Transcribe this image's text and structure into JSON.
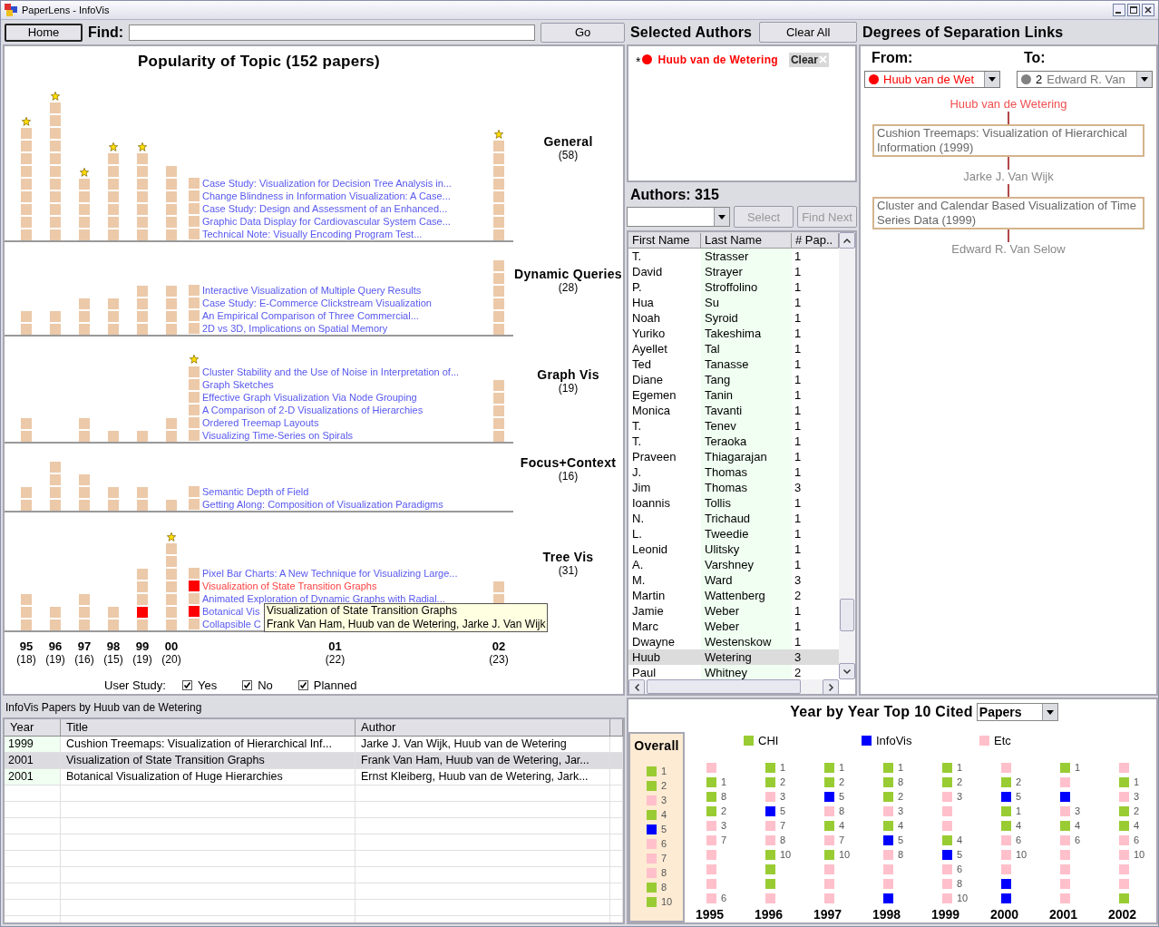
{
  "window": {
    "title": "PaperLens - InfoVis"
  },
  "toolbar": {
    "home": "Home",
    "find_label": "Find:",
    "go": "Go"
  },
  "popularity": {
    "title": "Popularity of Topic (152 papers)",
    "topics": [
      {
        "name": "General",
        "count": "(58)",
        "columns": [
          {
            "kind": "stack",
            "starred": true,
            "cells": [
              false,
              false,
              false,
              false,
              false,
              false,
              false,
              false,
              false
            ]
          },
          {
            "kind": "stack",
            "starred": true,
            "cells": [
              false,
              false,
              false,
              false,
              false,
              false,
              false,
              false,
              false,
              false,
              false
            ]
          },
          {
            "kind": "stack",
            "starred": true,
            "cells": [
              false,
              false,
              false,
              false,
              false
            ]
          },
          {
            "kind": "stack",
            "starred": true,
            "cells": [
              false,
              false,
              false,
              false,
              false,
              false,
              false
            ]
          },
          {
            "kind": "stack",
            "starred": true,
            "cells": [
              false,
              false,
              false,
              false,
              false,
              false,
              false
            ]
          },
          {
            "kind": "stack",
            "cells": [
              false,
              false,
              false,
              false,
              false,
              false
            ]
          },
          {
            "kind": "papers",
            "papers": [
              {
                "title": "Case Study: Visualization for Decision Tree Analysis in...",
                "highlighted": false,
                "hovered": false
              },
              {
                "title": "Change Blindness in Information Visualization: A Case...",
                "highlighted": false,
                "hovered": false
              },
              {
                "title": "Case Study: Design and Assessment of an Enhanced...",
                "highlighted": false,
                "hovered": false
              },
              {
                "title": "Graphic Data Display for Cardiovascular System Case...",
                "highlighted": false,
                "hovered": false
              },
              {
                "title": "Technical Note: Visually Encoding Program Test...",
                "highlighted": false,
                "hovered": false
              }
            ]
          },
          {
            "kind": "stack",
            "starred": true,
            "cells": [
              false,
              false,
              false,
              false,
              false,
              false,
              false,
              false
            ]
          }
        ]
      },
      {
        "name": "Dynamic Queries",
        "count": "(28)",
        "columns": [
          {
            "kind": "stack",
            "cells": [
              false,
              false
            ]
          },
          {
            "kind": "stack",
            "cells": [
              false,
              false
            ]
          },
          {
            "kind": "stack",
            "cells": [
              false,
              false,
              false
            ]
          },
          {
            "kind": "stack",
            "cells": [
              false,
              false,
              false
            ]
          },
          {
            "kind": "stack",
            "cells": [
              false,
              false,
              false,
              false
            ]
          },
          {
            "kind": "stack",
            "cells": [
              false,
              false,
              false,
              false
            ]
          },
          {
            "kind": "papers",
            "papers": [
              {
                "title": "Interactive Visualization of Multiple Query Results",
                "highlighted": false,
                "hovered": false
              },
              {
                "title": "Case Study: E-Commerce Clickstream Visualization",
                "highlighted": false,
                "hovered": false
              },
              {
                "title": "An Empirical Comparison of Three Commercial...",
                "highlighted": false,
                "hovered": false
              },
              {
                "title": "2D vs 3D, Implications on Spatial Memory",
                "highlighted": false,
                "hovered": false
              }
            ]
          },
          {
            "kind": "stack",
            "cells": [
              false,
              false,
              false,
              false,
              false,
              false
            ]
          }
        ]
      },
      {
        "name": "Graph Vis",
        "count": "(19)",
        "columns": [
          {
            "kind": "stack",
            "cells": [
              false,
              false
            ]
          },
          {
            "kind": "stack"
          },
          {
            "kind": "stack",
            "cells": [
              false,
              false
            ]
          },
          {
            "kind": "stack",
            "cells": [
              false
            ]
          },
          {
            "kind": "stack",
            "cells": [
              false
            ]
          },
          {
            "kind": "stack",
            "cells": [
              false,
              false
            ]
          },
          {
            "kind": "papers",
            "starred": true,
            "papers": [
              {
                "title": "Cluster Stability and the Use of Noise in Interpretation of...",
                "highlighted": false,
                "hovered": false
              },
              {
                "title": "Graph Sketches",
                "highlighted": false,
                "hovered": false
              },
              {
                "title": "Effective Graph Visualization Via Node Grouping",
                "highlighted": false,
                "hovered": false
              },
              {
                "title": "A Comparison of 2-D Visualizations of Hierarchies",
                "highlighted": false,
                "hovered": false
              },
              {
                "title": "Ordered Treemap Layouts",
                "highlighted": false,
                "hovered": false
              },
              {
                "title": "Visualizing Time-Series on Spirals",
                "highlighted": false,
                "hovered": false
              }
            ]
          },
          {
            "kind": "stack",
            "cells": [
              false,
              false,
              false,
              false,
              false
            ]
          }
        ]
      },
      {
        "name": "Focus+Context",
        "count": "(16)",
        "columns": [
          {
            "kind": "stack",
            "cells": [
              false,
              false
            ]
          },
          {
            "kind": "stack",
            "cells": [
              false,
              false,
              false,
              false
            ]
          },
          {
            "kind": "stack",
            "cells": [
              false,
              false,
              false
            ]
          },
          {
            "kind": "stack",
            "cells": [
              false,
              false
            ]
          },
          {
            "kind": "stack",
            "cells": [
              false,
              false
            ]
          },
          {
            "kind": "stack",
            "cells": [
              false
            ]
          },
          {
            "kind": "papers",
            "papers": [
              {
                "title": "Semantic Depth of Field",
                "highlighted": false,
                "hovered": false
              },
              {
                "title": "Getting Along: Composition of Visualization Paradigms",
                "highlighted": false,
                "hovered": false
              }
            ]
          },
          {
            "kind": "stack"
          }
        ]
      },
      {
        "name": "Tree Vis",
        "count": "(31)",
        "columns": [
          {
            "kind": "stack",
            "cells": [
              false,
              false,
              false
            ]
          },
          {
            "kind": "stack",
            "cells": [
              false,
              false
            ]
          },
          {
            "kind": "stack",
            "cells": [
              false,
              false,
              false
            ]
          },
          {
            "kind": "stack",
            "cells": [
              false,
              false
            ]
          },
          {
            "kind": "stack",
            "cells": [
              false,
              true,
              false,
              false,
              false
            ]
          },
          {
            "kind": "stack",
            "starred": true,
            "cells": [
              false,
              false,
              false,
              false,
              false,
              false,
              false
            ]
          },
          {
            "kind": "papers",
            "papers": [
              {
                "title": "Pixel Bar Charts: A New Technique for Visualizing Large...",
                "highlighted": false,
                "hovered": false
              },
              {
                "title": "Visualization of State Transition Graphs",
                "highlighted": true,
                "hovered": true
              },
              {
                "title": "Animated Exploration of Dynamic Graphs with Radial...",
                "highlighted": false,
                "hovered": false
              },
              {
                "title": "Botanical Vis",
                "highlighted": true,
                "hovered": false
              },
              {
                "title": "Collapsible C",
                "highlighted": false,
                "hovered": false
              }
            ],
            "tooltip": {
              "title": "Visualization of State Transition Graphs",
              "authors": "Frank Van Ham, Huub van de Wetering, Jarke J. Van Wijk"
            }
          },
          {
            "kind": "stack",
            "cells": [
              false,
              false
            ]
          }
        ]
      }
    ],
    "axis": [
      {
        "label": "95",
        "count": "(18)"
      },
      {
        "label": "96",
        "count": "(19)"
      },
      {
        "label": "97",
        "count": "(16)"
      },
      {
        "label": "98",
        "count": "(15)"
      },
      {
        "label": "99",
        "count": "(19)"
      },
      {
        "label": "00",
        "count": "(20)"
      },
      {
        "label": "01",
        "count": "(22)"
      },
      {
        "label": "02",
        "count": "(23)"
      }
    ],
    "user_study": {
      "label": "User Study:",
      "options": [
        {
          "label": "Yes",
          "checked": true
        },
        {
          "label": "No",
          "checked": true
        },
        {
          "label": "Planned",
          "checked": true
        }
      ]
    }
  },
  "selected_authors": {
    "header": "Selected Authors",
    "clear_all": "Clear All",
    "items": [
      {
        "marker": "*",
        "name": "Huub van de Wetering",
        "color": "#ff0000",
        "clear": "Clear"
      }
    ]
  },
  "authors": {
    "header": "Authors: 315",
    "select": "Select",
    "find_next": "Find Next",
    "buttons_disabled": true,
    "columns": [
      "First Name",
      "Last Name",
      "# Pap.."
    ],
    "rows": [
      {
        "first": "T.",
        "last": "Strasser",
        "papers": "1",
        "selected": false
      },
      {
        "first": "David",
        "last": "Strayer",
        "papers": "1",
        "selected": false
      },
      {
        "first": "P.",
        "last": "Stroffolino",
        "papers": "1",
        "selected": false
      },
      {
        "first": "Hua",
        "last": "Su",
        "papers": "1",
        "selected": false
      },
      {
        "first": "Noah",
        "last": "Syroid",
        "papers": "1",
        "selected": false
      },
      {
        "first": "Yuriko",
        "last": "Takeshima",
        "papers": "1",
        "selected": false
      },
      {
        "first": "Ayellet",
        "last": "Tal",
        "papers": "1",
        "selected": false
      },
      {
        "first": "Ted",
        "last": "Tanasse",
        "papers": "1",
        "selected": false
      },
      {
        "first": "Diane",
        "last": "Tang",
        "papers": "1",
        "selected": false
      },
      {
        "first": "Egemen",
        "last": "Tanin",
        "papers": "1",
        "selected": false
      },
      {
        "first": "Monica",
        "last": "Tavanti",
        "papers": "1",
        "selected": false
      },
      {
        "first": "T.",
        "last": "Tenev",
        "papers": "1",
        "selected": false
      },
      {
        "first": "T.",
        "last": "Teraoka",
        "papers": "1",
        "selected": false
      },
      {
        "first": "Praveen",
        "last": "Thiagarajan",
        "papers": "1",
        "selected": false
      },
      {
        "first": "J.",
        "last": "Thomas",
        "papers": "1",
        "selected": false
      },
      {
        "first": "Jim",
        "last": "Thomas",
        "papers": "3",
        "selected": false
      },
      {
        "first": "Ioannis",
        "last": "Tollis",
        "papers": "1",
        "selected": false
      },
      {
        "first": "N.",
        "last": "Trichaud",
        "papers": "1",
        "selected": false
      },
      {
        "first": "L.",
        "last": "Tweedie",
        "papers": "1",
        "selected": false
      },
      {
        "first": "Leonid",
        "last": "Ulitsky",
        "papers": "1",
        "selected": false
      },
      {
        "first": "A.",
        "last": "Varshney",
        "papers": "1",
        "selected": false
      },
      {
        "first": "M.",
        "last": "Ward",
        "papers": "3",
        "selected": false
      },
      {
        "first": "Martin",
        "last": "Wattenberg",
        "papers": "2",
        "selected": false
      },
      {
        "first": "Jamie",
        "last": "Weber",
        "papers": "1",
        "selected": false
      },
      {
        "first": "Marc",
        "last": "Weber",
        "papers": "1",
        "selected": false
      },
      {
        "first": "Dwayne",
        "last": "Westenskow",
        "papers": "1",
        "selected": false
      },
      {
        "first": "Huub",
        "last": "Wetering",
        "papers": "3",
        "selected": true
      },
      {
        "first": "Paul",
        "last": "Whitney",
        "papers": "2",
        "selected": false
      }
    ]
  },
  "degrees": {
    "header": "Degrees of Separation Links",
    "from_label": "From:",
    "to_label": "To:",
    "from": {
      "color": "#ff0000",
      "value": "Huub van de Wet"
    },
    "to": {
      "color": "#808080",
      "index": "2",
      "value": "Edward R. Van"
    },
    "chain": [
      {
        "kind": "author",
        "text": "Huub van de Wetering",
        "highlighted": true
      },
      {
        "kind": "paper",
        "text": "Cushion Treemaps: Visualization of Hierarchical Information (1999)"
      },
      {
        "kind": "author",
        "text": "Jarke J. Van Wijk",
        "highlighted": false
      },
      {
        "kind": "paper",
        "text": "Cluster and Calendar Based Visualization of Time Series Data (1999)"
      },
      {
        "kind": "author",
        "text": "Edward R. Van Selow",
        "highlighted": false
      }
    ]
  },
  "papers_table": {
    "title": "InfoVis Papers by Huub van de Wetering",
    "columns": [
      "Year",
      "Title",
      "Author"
    ],
    "rows": [
      {
        "year": "1999",
        "title": "Cushion Treemaps: Visualization of Hierarchical Inf...",
        "author": "Jarke J. Van Wijk, Huub van de Wetering",
        "selected": false
      },
      {
        "year": "2001",
        "title": "Visualization of State Transition Graphs",
        "author": "Frank Van Ham, Huub van de Wetering, Jar...",
        "selected": true
      },
      {
        "year": "2001",
        "title": "Botanical Visualization of Huge Hierarchies",
        "author": "Ernst Kleiberg, Huub van de Wetering, Jark...",
        "selected": false
      }
    ]
  },
  "top10": {
    "title": "Year by Year Top 10 Cited",
    "mode": "Papers",
    "legend": [
      {
        "name": "CHI",
        "color": "#99cc33"
      },
      {
        "name": "InfoVis",
        "color": "#0000ff"
      },
      {
        "name": "Etc",
        "color": "#ffc0cb"
      }
    ],
    "overall": {
      "label": "Overall",
      "items": [
        {
          "color": "#99cc33",
          "rank": "1"
        },
        {
          "color": "#99cc33",
          "rank": "2"
        },
        {
          "color": "#ffc0cb",
          "rank": "3"
        },
        {
          "color": "#99cc33",
          "rank": "4"
        },
        {
          "color": "#0000ff",
          "rank": "5"
        },
        {
          "color": "#ffc0cb",
          "rank": "6"
        },
        {
          "color": "#ffc0cb",
          "rank": "7"
        },
        {
          "color": "#ffc0cb",
          "rank": "8"
        },
        {
          "color": "#99cc33",
          "rank": "8"
        },
        {
          "color": "#99cc33",
          "rank": "10"
        }
      ]
    },
    "years": [
      {
        "year": "1995",
        "items": [
          {
            "color": "#ffc0cb"
          },
          {
            "color": "#99cc33",
            "rank": "1"
          },
          {
            "color": "#99cc33",
            "rank": "8"
          },
          {
            "color": "#99cc33",
            "rank": "2"
          },
          {
            "color": "#ffc0cb",
            "rank": "3"
          },
          {
            "color": "#ffc0cb",
            "rank": "7"
          },
          {
            "color": "#ffc0cb"
          },
          {
            "color": "#ffc0cb"
          },
          {
            "color": "#ffc0cb"
          },
          {
            "color": "#ffc0cb",
            "rank": "6"
          }
        ]
      },
      {
        "year": "1996",
        "items": [
          {
            "color": "#99cc33",
            "rank": "1"
          },
          {
            "color": "#99cc33",
            "rank": "2"
          },
          {
            "color": "#ffc0cb",
            "rank": "3"
          },
          {
            "color": "#0000ff",
            "rank": "5"
          },
          {
            "color": "#ffc0cb",
            "rank": "7"
          },
          {
            "color": "#ffc0cb",
            "rank": "8"
          },
          {
            "color": "#99cc33",
            "rank": "10"
          },
          {
            "color": "#99cc33"
          },
          {
            "color": "#99cc33"
          },
          {
            "color": "#ffc0cb"
          }
        ]
      },
      {
        "year": "1997",
        "items": [
          {
            "color": "#99cc33",
            "rank": "1"
          },
          {
            "color": "#99cc33",
            "rank": "2"
          },
          {
            "color": "#0000ff",
            "rank": "5"
          },
          {
            "color": "#ffc0cb",
            "rank": "8"
          },
          {
            "color": "#99cc33",
            "rank": "4"
          },
          {
            "color": "#ffc0cb",
            "rank": "7"
          },
          {
            "color": "#99cc33",
            "rank": "10"
          },
          {
            "color": "#ffc0cb"
          },
          {
            "color": "#ffc0cb"
          },
          {
            "color": "#ffc0cb"
          }
        ]
      },
      {
        "year": "1998",
        "items": [
          {
            "color": "#99cc33",
            "rank": "1"
          },
          {
            "color": "#99cc33",
            "rank": "8"
          },
          {
            "color": "#99cc33",
            "rank": "2"
          },
          {
            "color": "#ffc0cb",
            "rank": "3"
          },
          {
            "color": "#99cc33",
            "rank": "4"
          },
          {
            "color": "#0000ff",
            "rank": "5"
          },
          {
            "color": "#ffc0cb",
            "rank": "8"
          },
          {
            "color": "#ffc0cb"
          },
          {
            "color": "#ffc0cb"
          },
          {
            "color": "#0000ff"
          }
        ]
      },
      {
        "year": "1999",
        "items": [
          {
            "color": "#99cc33",
            "rank": "1"
          },
          {
            "color": "#99cc33",
            "rank": "2"
          },
          {
            "color": "#ffc0cb",
            "rank": "3"
          },
          {
            "color": "#ffc0cb"
          },
          {
            "color": "#ffc0cb"
          },
          {
            "color": "#99cc33",
            "rank": "4"
          },
          {
            "color": "#0000ff",
            "rank": "5"
          },
          {
            "color": "#ffc0cb",
            "rank": "6"
          },
          {
            "color": "#ffc0cb",
            "rank": "8"
          },
          {
            "color": "#ffc0cb",
            "rank": "10"
          }
        ]
      },
      {
        "year": "2000",
        "items": [
          {
            "color": "#ffc0cb"
          },
          {
            "color": "#99cc33",
            "rank": "2"
          },
          {
            "color": "#0000ff",
            "rank": "5"
          },
          {
            "color": "#99cc33",
            "rank": "1"
          },
          {
            "color": "#99cc33",
            "rank": "4"
          },
          {
            "color": "#ffc0cb",
            "rank": "6"
          },
          {
            "color": "#ffc0cb",
            "rank": "10"
          },
          {
            "color": "#ffc0cb"
          },
          {
            "color": "#0000ff"
          },
          {
            "color": "#0000ff"
          }
        ]
      },
      {
        "year": "2001",
        "items": [
          {
            "color": "#99cc33",
            "rank": "1"
          },
          {
            "color": "#ffc0cb"
          },
          {
            "color": "#0000ff"
          },
          {
            "color": "#ffc0cb",
            "rank": "3"
          },
          {
            "color": "#99cc33",
            "rank": "4"
          },
          {
            "color": "#ffc0cb",
            "rank": "6"
          },
          {
            "color": "#ffc0cb"
          },
          {
            "color": "#ffc0cb"
          },
          {
            "color": "#ffc0cb"
          },
          {
            "color": "#ffc0cb"
          }
        ]
      },
      {
        "year": "2002",
        "items": [
          {
            "color": "#ffc0cb"
          },
          {
            "color": "#99cc33",
            "rank": "1"
          },
          {
            "color": "#ffc0cb",
            "rank": "3"
          },
          {
            "color": "#99cc33",
            "rank": "2"
          },
          {
            "color": "#99cc33",
            "rank": "4"
          },
          {
            "color": "#ffc0cb",
            "rank": "6"
          },
          {
            "color": "#ffc0cb",
            "rank": "10"
          },
          {
            "color": "#ffc0cb"
          },
          {
            "color": "#ffc0cb"
          },
          {
            "color": "#99cc33"
          }
        ]
      }
    ]
  }
}
